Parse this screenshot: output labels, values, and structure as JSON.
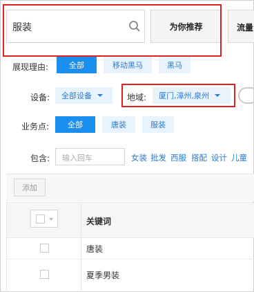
{
  "search": {
    "value": "服装"
  },
  "top_buttons": {
    "recommend": "为你推荐",
    "flow": "流量"
  },
  "filters": {
    "reason": {
      "label": "展现理由:",
      "options": [
        "全部",
        "移动黑马",
        "黑马"
      ],
      "selected": 0
    },
    "device": {
      "label": "设备:",
      "value": "全部设备"
    },
    "region": {
      "label": "地域:",
      "value": "厦门,漳州,泉州"
    },
    "business": {
      "label": "业务点:",
      "options": [
        "全部",
        "唐装",
        "服装"
      ],
      "selected": 0
    },
    "contains": {
      "label": "包含:",
      "placeholder": "输入回车",
      "keywords": [
        "女装",
        "批发",
        "西服",
        "搭配",
        "设计",
        "儿童"
      ]
    }
  },
  "toolbar": {
    "add_label": "添加"
  },
  "table": {
    "header": "关键词",
    "rows": [
      {
        "keyword": "唐装"
      },
      {
        "keyword": "夏季男装"
      }
    ]
  },
  "colors": {
    "accent": "#1b8ff0",
    "highlight": "#e02020"
  }
}
